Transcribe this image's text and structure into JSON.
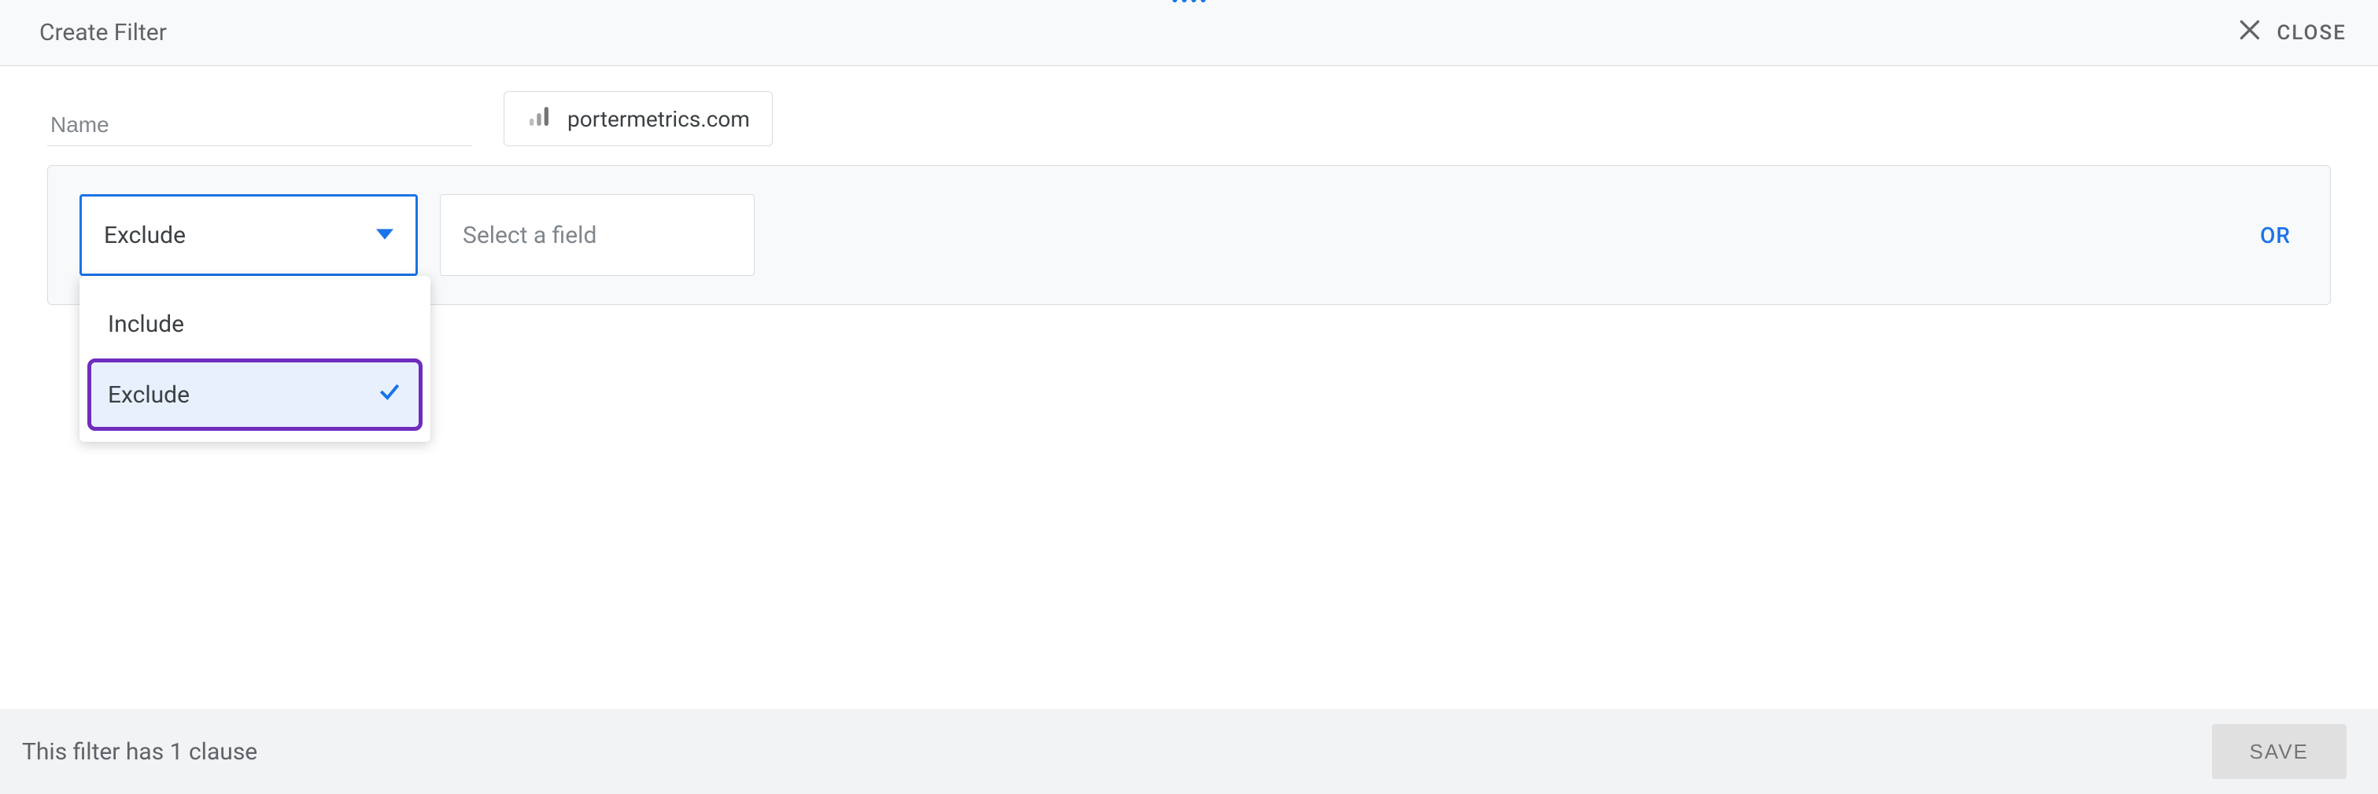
{
  "header": {
    "title": "Create Filter",
    "close_label": "CLOSE"
  },
  "config": {
    "name_placeholder": "Name",
    "name_value": "",
    "datasource": "portermetrics.com"
  },
  "builder": {
    "condition_select": {
      "value": "Exclude",
      "options": [
        {
          "label": "Include",
          "selected": false
        },
        {
          "label": "Exclude",
          "selected": true
        }
      ]
    },
    "field_placeholder": "Select a field",
    "or_label": "OR"
  },
  "footer": {
    "status": "This filter has 1 clause",
    "save_label": "SAVE"
  }
}
